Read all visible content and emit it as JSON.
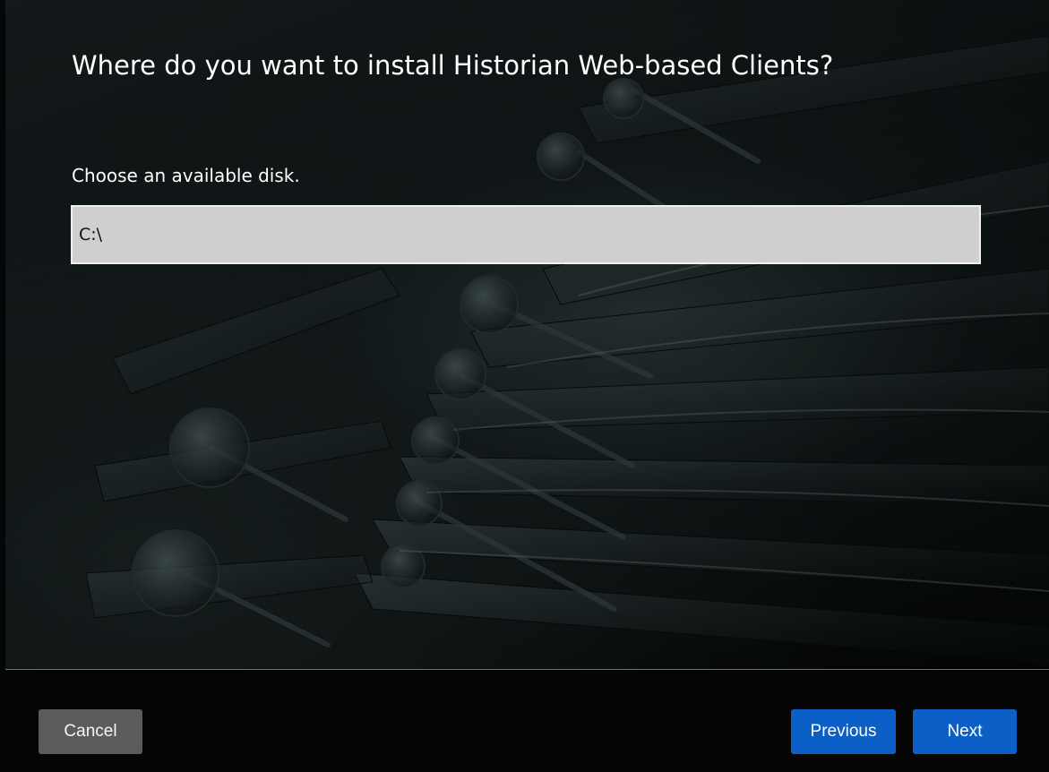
{
  "installer": {
    "title": "Where do you want to install Historian Web-based Clients?",
    "prompt": "Choose an available disk.",
    "disk_select": {
      "value": "C:\\"
    }
  },
  "footer": {
    "cancel_label": "Cancel",
    "previous_label": "Previous",
    "next_label": "Next"
  },
  "colors": {
    "primary_button": "#0b5fc6",
    "secondary_button": "#5b5b5b",
    "input_background": "#cfcfcf"
  }
}
